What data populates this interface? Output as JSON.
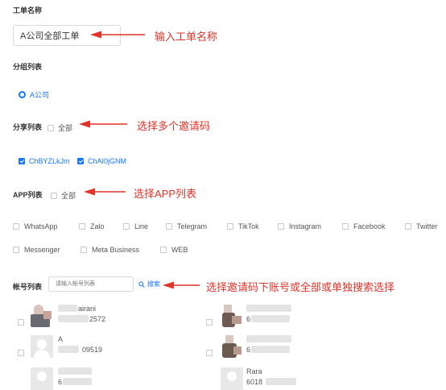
{
  "ticket_name": {
    "label": "工单名称",
    "value": "A公司全部工单",
    "annotation": "输入工单名称"
  },
  "group_list": {
    "label": "分组列表",
    "option": "A公司"
  },
  "share_list": {
    "label": "分享列表",
    "all_label": "全部",
    "annotation": "选择多个邀请码",
    "codes": [
      "ChBYZLkJm",
      "ChAI0jGNM"
    ]
  },
  "app_list": {
    "label": "APP列表",
    "all_label": "全部",
    "annotation": "选择APP列表",
    "apps_row1": [
      "WhatsApp",
      "Zalo",
      "Line",
      "Telegram",
      "TikTok",
      "Instagram",
      "Facebook",
      "Twitter"
    ],
    "apps_row2": [
      "Messenger",
      "Meta Business",
      "WEB"
    ]
  },
  "account_list": {
    "label": "帐号列表",
    "search_placeholder": "请输入帐号列表",
    "search_button": "搜索",
    "annotation": "选择邀请码下账号或全部或单独搜索选择",
    "accounts": [
      {
        "name": "airani",
        "id": "2572"
      },
      {
        "name": "",
        "id": "6"
      },
      {
        "name": "A",
        "id": "09519"
      },
      {
        "name": "",
        "id": "6"
      },
      {
        "name": "",
        "id": "6"
      },
      {
        "name": "Rara",
        "id": "6018"
      }
    ]
  },
  "colors": {
    "accent": "#1677ff",
    "annotation": "#e0342a",
    "text": "#333333"
  },
  "icons": {
    "search": "search-icon",
    "arrow": "red-arrow-icon"
  }
}
